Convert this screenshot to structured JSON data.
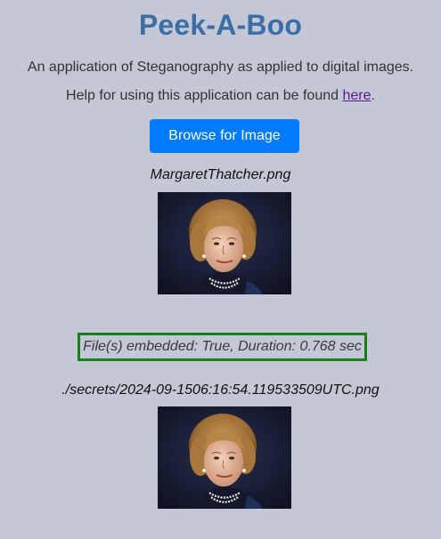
{
  "app": {
    "title": "Peek-A-Boo",
    "description": "An application of Steganography as applied to digital images.",
    "help_prefix": "Help for using this application can be found ",
    "help_link": "here",
    "help_suffix": "."
  },
  "browse": {
    "label": "Browse for Image"
  },
  "input_image": {
    "filename": "MargaretThatcher.png"
  },
  "result": {
    "status": "File(s) embedded: True, Duration: 0.768 sec",
    "output_filename": "./secrets/2024-09-1506:16:54.119533509UTC.png"
  },
  "colors": {
    "background": "#c3c7d6",
    "title": "#3a6ea5",
    "button": "#007bff",
    "status_border": "#1a7f1a"
  },
  "icons": {
    "input_photo": "portrait-photo",
    "output_photo": "portrait-photo"
  }
}
